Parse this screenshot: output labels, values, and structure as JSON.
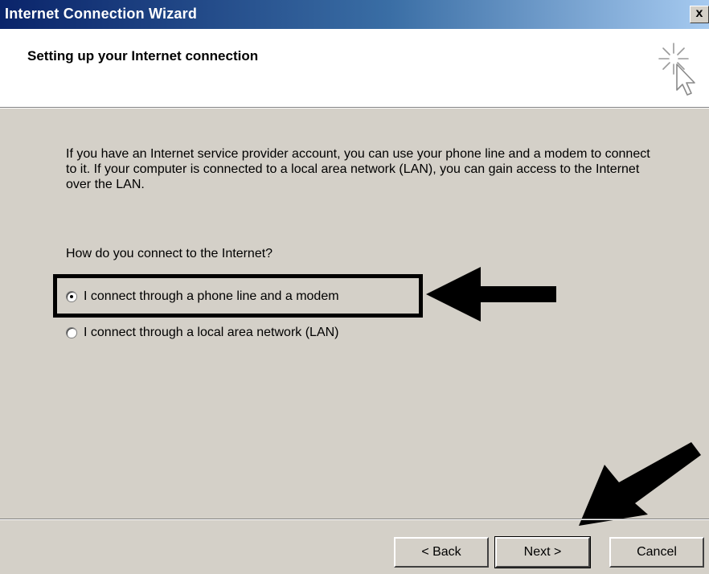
{
  "window": {
    "title": "Internet Connection Wizard",
    "close_label": "x"
  },
  "header": {
    "title": "Setting up your Internet connection",
    "icon": "wizard-cursor-sparkle-icon"
  },
  "body": {
    "description": "If you have an Internet service provider account, you can use your phone line and a modem to connect to it. If your computer is connected to a local area network (LAN), you can gain access to the Internet over the LAN.",
    "question": "How do you connect to the Internet?",
    "options": [
      {
        "label": "I connect through a phone line and a modem",
        "selected": true
      },
      {
        "label": "I connect through a local area network (LAN)",
        "selected": false
      }
    ]
  },
  "footer": {
    "back_label": "< Back",
    "next_label": "Next >",
    "cancel_label": "Cancel"
  },
  "colors": {
    "titlebar_start": "#0a246a",
    "titlebar_end": "#a6caf0",
    "dialog_background": "#d4d0c8",
    "header_background": "#ffffff",
    "annotation": "#000000"
  }
}
